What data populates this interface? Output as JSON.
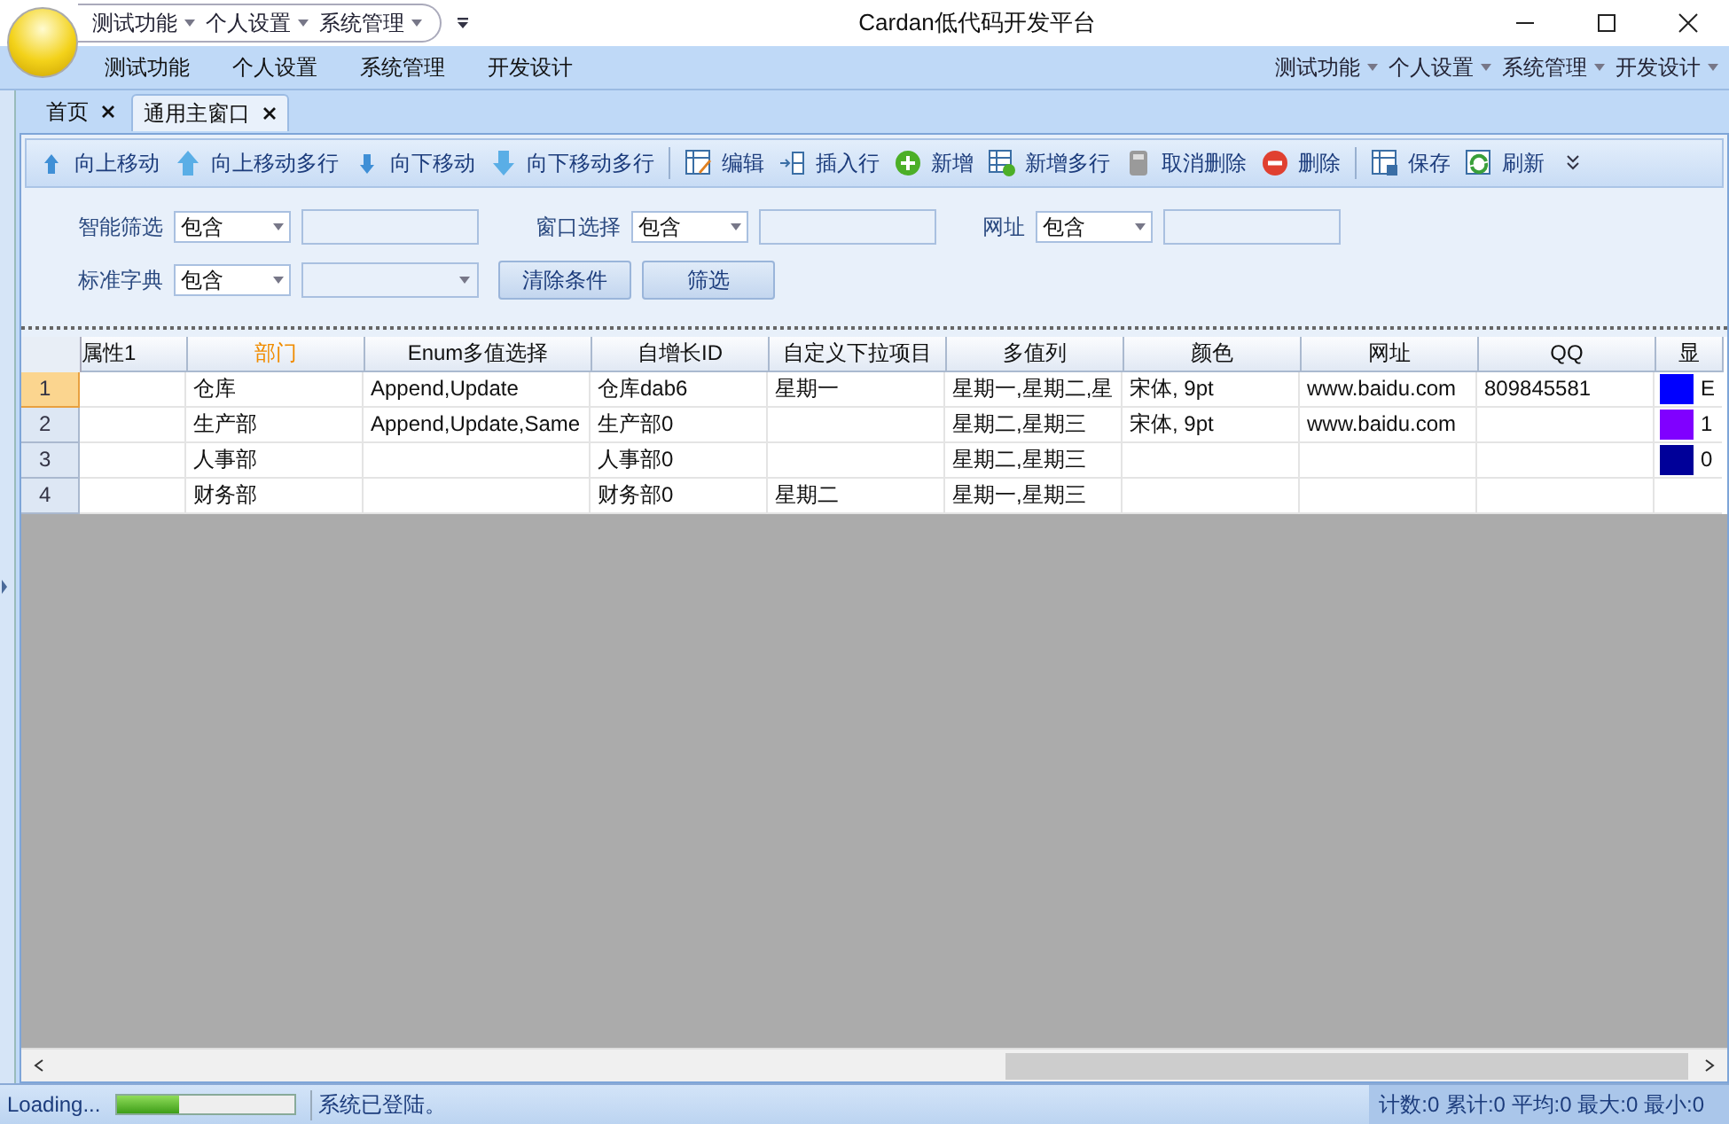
{
  "window": {
    "title": "Cardan低代码开发平台"
  },
  "quick_access": [
    "测试功能",
    "个人设置",
    "系统管理"
  ],
  "ribbon_tabs": [
    "测试功能",
    "个人设置",
    "系统管理",
    "开发设计"
  ],
  "ribbon_menus": [
    "测试功能",
    "个人设置",
    "系统管理",
    "开发设计"
  ],
  "doc_tabs": [
    {
      "label": "首页",
      "selected": false
    },
    {
      "label": "通用主窗口",
      "selected": true
    }
  ],
  "toolbar": [
    {
      "label": "向上移动",
      "kind": "up",
      "separator_before": false
    },
    {
      "label": "向上移动多行",
      "kind": "upbig",
      "separator_before": false
    },
    {
      "label": "向下移动",
      "kind": "down",
      "separator_before": false
    },
    {
      "label": "向下移动多行",
      "kind": "downbig",
      "separator_before": false
    },
    {
      "label": "编辑",
      "kind": "edit",
      "separator_before": true
    },
    {
      "label": "插入行",
      "kind": "insert",
      "separator_before": false
    },
    {
      "label": "新增",
      "kind": "add",
      "separator_before": false
    },
    {
      "label": "新增多行",
      "kind": "addrows",
      "separator_before": false
    },
    {
      "label": "取消删除",
      "kind": "undo",
      "separator_before": false
    },
    {
      "label": "删除",
      "kind": "delete",
      "separator_before": false
    },
    {
      "label": "保存",
      "kind": "save",
      "separator_before": true
    },
    {
      "label": "刷新",
      "kind": "refresh",
      "separator_before": false
    }
  ],
  "filters": [
    {
      "label": "智能筛选",
      "operator": "包含",
      "kind": "text"
    },
    {
      "label": "窗口选择",
      "operator": "包含",
      "kind": "text"
    },
    {
      "label": "网址",
      "operator": "包含",
      "kind": "text"
    },
    {
      "label": "标准字典",
      "operator": "包含",
      "kind": "combo"
    }
  ],
  "filter_buttons": [
    "清除条件",
    "筛选"
  ],
  "table": {
    "columns": [
      {
        "label": "属性1",
        "selected": false
      },
      {
        "label": "部门",
        "selected": true
      },
      {
        "label": "Enum多值选择",
        "selected": false
      },
      {
        "label": "自增长ID",
        "selected": false
      },
      {
        "label": "自定义下拉项目",
        "selected": false
      },
      {
        "label": "多值列",
        "selected": false
      },
      {
        "label": "颜色",
        "selected": false
      },
      {
        "label": "网址",
        "selected": false
      },
      {
        "label": "QQ",
        "selected": false
      },
      {
        "label": "显",
        "selected": false
      }
    ],
    "rows": [
      {
        "number": "1",
        "selected": true,
        "cells": [
          "",
          "仓库",
          "Append,Update",
          "仓库dab6",
          "星期一",
          "星期一,星期二,星",
          "宋体, 9pt",
          "www.baidu.com",
          "809845581"
        ],
        "color": "#0000ff",
        "last": "E"
      },
      {
        "number": "2",
        "selected": false,
        "cells": [
          "",
          "生产部",
          "Append,Update,Same",
          "生产部0",
          "",
          "星期二,星期三",
          "宋体, 9pt",
          "www.baidu.com",
          ""
        ],
        "color": "#8000ff",
        "last": "1"
      },
      {
        "number": "3",
        "selected": false,
        "cells": [
          "",
          "人事部",
          "",
          "人事部0",
          "",
          "星期二,星期三",
          "",
          "",
          ""
        ],
        "color": "#000099",
        "last": "0"
      },
      {
        "number": "4",
        "selected": false,
        "cells": [
          "",
          "财务部",
          "",
          "财务部0",
          "星期二",
          "星期一,星期三",
          "",
          "",
          ""
        ],
        "color": null,
        "last": ""
      }
    ]
  },
  "status_bar": {
    "loading": "Loading...",
    "level": 0.35,
    "message": "系统已登陆。",
    "summary": "计数:0 累计:0 平均:0 最大:0 最小:0"
  }
}
